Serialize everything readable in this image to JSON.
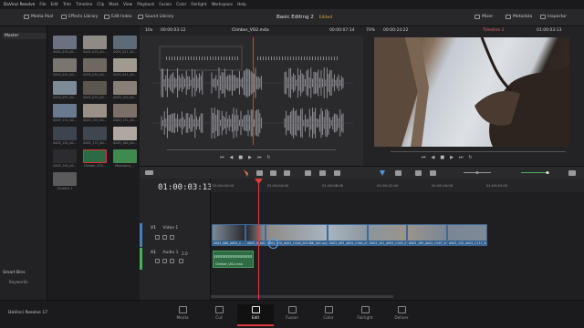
{
  "menu": [
    "DaVinci Resolve",
    "File",
    "Edit",
    "Trim",
    "Timeline",
    "Clip",
    "Mark",
    "View",
    "Playback",
    "Fusion",
    "Color",
    "Fairlight",
    "Workspace",
    "Help"
  ],
  "toolbar": {
    "media_pool": "Media Pool",
    "effects_library": "Effects Library",
    "edit_index": "Edit Index",
    "sound_library": "Sound Library",
    "project_title": "Basic Editing 2",
    "status": "Edited",
    "mixer": "Mixer",
    "metadata": "Metadata",
    "inspector": "Inspector"
  },
  "bins": {
    "master": "Master",
    "smart_bins": "Smart Bins",
    "keywords": "Keywords"
  },
  "media_pool": {
    "clips": [
      {
        "label": "0002_018_A0...",
        "color": "#6a7180"
      },
      {
        "label": "0003_028_A0...",
        "color": "#8e8a86"
      },
      {
        "label": "0003_021_A0...",
        "color": "#5d6a78"
      },
      {
        "label": "0003_045_A0...",
        "color": "#7a7570"
      },
      {
        "label": "0003_030_A0...",
        "color": "#6e6860"
      },
      {
        "label": "0003_041_A0...",
        "color": "#a09a90"
      },
      {
        "label": "0003_055_A0...",
        "color": "#7d8a98"
      },
      {
        "label": "0003_070_A0...",
        "color": "#5c5650"
      },
      {
        "label": "0003_100_A0...",
        "color": "#888078"
      },
      {
        "label": "0003_112_A0...",
        "color": "#6a7a8e"
      },
      {
        "label": "0003_120_A0...",
        "color": "#9a9088"
      },
      {
        "label": "0003_131_A0...",
        "color": "#7a7068"
      },
      {
        "label": "0003_150_A0...",
        "color": "#3d4450"
      },
      {
        "label": "0003_175_A0...",
        "color": "#404650"
      },
      {
        "label": "0003_180_A0...",
        "color": "#b0a8a0"
      },
      {
        "label": "0003_190_A0...",
        "color": "#2b2b30"
      },
      {
        "label": "Climber_VO2...",
        "color": "#2d6a44"
      },
      {
        "label": "Mountains_...",
        "color": "#3f8a4e"
      },
      {
        "label": "Timeline 1",
        "color": "#5a5a5a"
      }
    ]
  },
  "source": {
    "zoom": "10x",
    "tc_in": "00:00:03:12",
    "clip_name": "Climber_VO2.m4a",
    "tc_dur": "00:00:07:14"
  },
  "program": {
    "zoom": "70%",
    "tc_dur": "00:00:24:22",
    "timeline_name": "Timeline 1",
    "tc_pos": "01:00:03:13"
  },
  "timeline": {
    "timecode": "01:00:03:13",
    "ruler": [
      "01:00:00:00",
      "01:00:04:00",
      "01:00:08:00",
      "01:00:12:00",
      "01:00:16:00",
      "01:00:20:00"
    ],
    "video_track": "V1",
    "video_track_name": "Video 1",
    "audio_track": "A1",
    "audio_track_name": "Audio 1",
    "audio_level": "2.0",
    "audio_clip": "Climber_VO2.m4a",
    "video_clips": [
      "0003_066_A001_C...",
      "0003_0_A001_C...",
      "0003_070_A001_C040_00148K_001.mp4",
      "0003_085_A001_C064_00...",
      "0003_101_A001_C005_001...",
      "0003_165_A001_C007_0014...",
      "0003_120_A001_C117_0014..."
    ]
  },
  "pages": [
    "Media",
    "Cut",
    "Edit",
    "Fusion",
    "Color",
    "Fairlight",
    "Deliver"
  ],
  "active_page": "Edit",
  "footer": {
    "app": "DaVinci Resolve 17"
  }
}
